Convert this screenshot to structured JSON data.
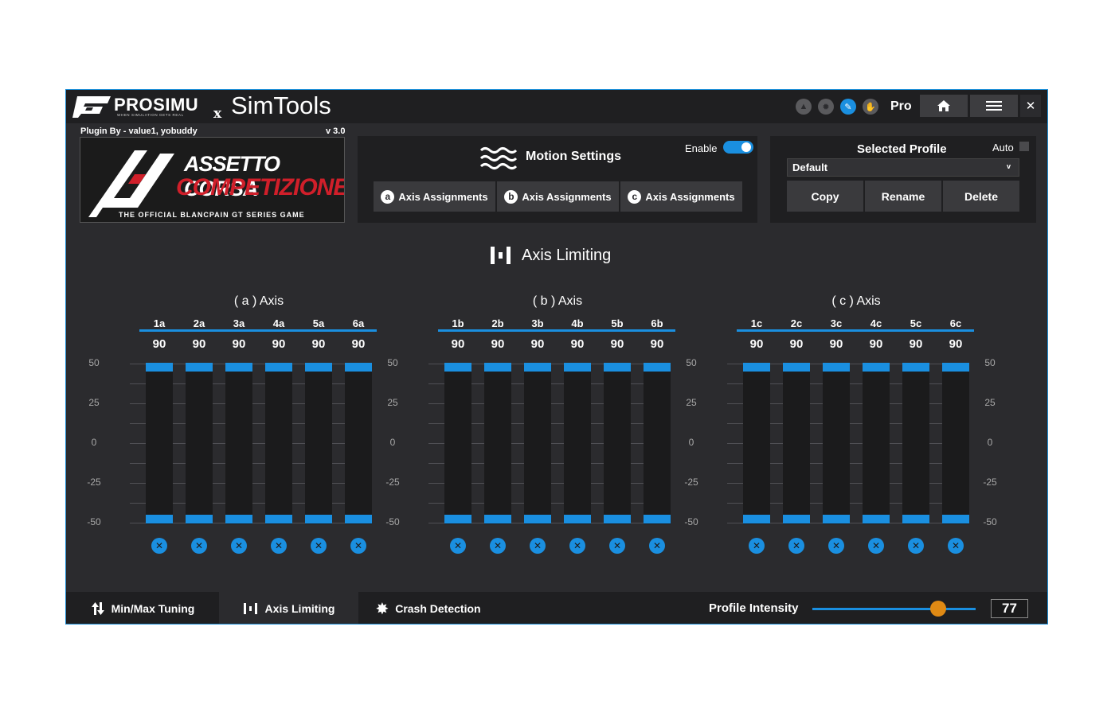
{
  "titlebar": {
    "brand": "PROSIMU",
    "brand_tagline": "WHEN SIMULATION GETS REAL",
    "x_mark": "x",
    "app_name": "SimTools",
    "tier": "Pro",
    "icons": [
      "up-arrow-icon",
      "gear-icon",
      "pen-icon",
      "wheel-icon"
    ]
  },
  "plugin": {
    "credit": "Plugin By - value1, yobuddy",
    "version": "v 3.0",
    "game_logo_line1": "ASSETTO CORSA",
    "game_logo_line2": "COMPETIZIONE",
    "game_logo_tagline": "THE OFFICIAL BLANCPAIN GT SERIES GAME"
  },
  "motion_settings": {
    "title": "Motion Settings",
    "enable_label": "Enable",
    "enabled": true,
    "buttons": [
      {
        "letter": "a",
        "label": "Axis Assignments"
      },
      {
        "letter": "b",
        "label": "Axis Assignments"
      },
      {
        "letter": "c",
        "label": "Axis Assignments"
      }
    ]
  },
  "profile": {
    "title": "Selected Profile",
    "auto_label": "Auto",
    "auto_checked": false,
    "selected": "Default",
    "buttons": {
      "copy": "Copy",
      "rename": "Rename",
      "delete": "Delete"
    }
  },
  "section_title": "Axis Limiting",
  "axis_groups": [
    {
      "title": "( a ) Axis",
      "columns": [
        "1a",
        "2a",
        "3a",
        "4a",
        "5a",
        "6a"
      ],
      "values": [
        "90",
        "90",
        "90",
        "90",
        "90",
        "90"
      ]
    },
    {
      "title": "( b ) Axis",
      "columns": [
        "1b",
        "2b",
        "3b",
        "4b",
        "5b",
        "6b"
      ],
      "values": [
        "90",
        "90",
        "90",
        "90",
        "90",
        "90"
      ]
    },
    {
      "title": "( c ) Axis",
      "columns": [
        "1c",
        "2c",
        "3c",
        "4c",
        "5c",
        "6c"
      ],
      "values": [
        "90",
        "90",
        "90",
        "90",
        "90",
        "90"
      ]
    }
  ],
  "scale_ticks": [
    "50",
    "25",
    "0",
    "-25",
    "-50"
  ],
  "limit_range": {
    "upper": 50,
    "lower": -50
  },
  "bottom_tabs": [
    {
      "label": "Min/Max Tuning",
      "icon": "updown-arrows-icon",
      "active": false
    },
    {
      "label": "Axis Limiting",
      "icon": "bars-icon",
      "active": true
    },
    {
      "label": "Crash Detection",
      "icon": "burst-icon",
      "active": false
    }
  ],
  "profile_intensity": {
    "label": "Profile Intensity",
    "value": "77",
    "fraction": 0.77
  },
  "colors": {
    "accent": "#1a8fe0",
    "knob": "#e08a14",
    "window_bg": "#2b2b2e",
    "panel_bg": "#1f1f21",
    "button_bg": "#3a3a3d"
  }
}
